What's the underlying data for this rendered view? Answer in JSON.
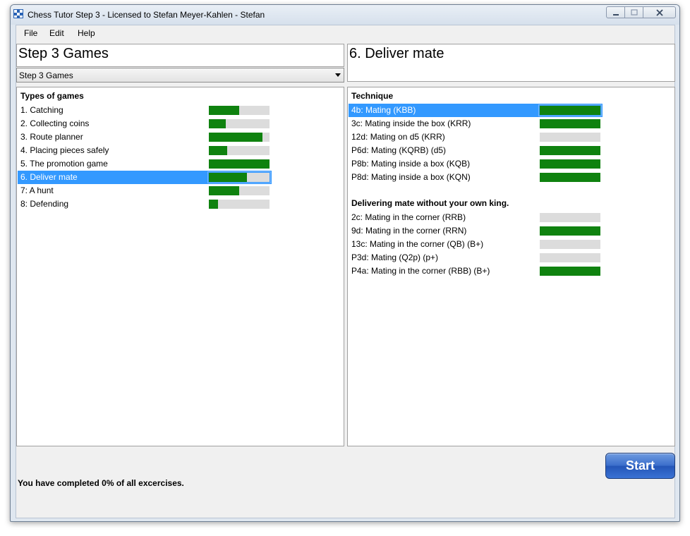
{
  "window": {
    "title": "Chess Tutor Step 3 - Licensed to Stefan Meyer-Kahlen - Stefan"
  },
  "menu": [
    "File",
    "Edit",
    "Help"
  ],
  "left_header": {
    "title": "Step 3 Games",
    "combo_value": "Step 3 Games"
  },
  "right_header": {
    "title": "6. Deliver mate"
  },
  "games": {
    "heading": "Types of games",
    "items": [
      {
        "label": "1. Catching",
        "progress": 0.5
      },
      {
        "label": "2. Collecting coins",
        "progress": 0.28
      },
      {
        "label": "3. Route planner",
        "progress": 0.88
      },
      {
        "label": "4. Placing pieces safely",
        "progress": 0.3
      },
      {
        "label": "5. The promotion game",
        "progress": 1.0
      },
      {
        "label": "6. Deliver mate",
        "progress": 0.63,
        "selected": true
      },
      {
        "label": "7: A hunt",
        "progress": 0.5
      },
      {
        "label": "8: Defending",
        "progress": 0.15
      }
    ]
  },
  "technique": {
    "heading": "Technique",
    "items": [
      {
        "label": "4b: Mating (KBB)",
        "progress": 1.0,
        "selected": true
      },
      {
        "label": "3c: Mating inside the box (KRR)",
        "progress": 1.0
      },
      {
        "label": "12d: Mating on d5 (KRR)",
        "progress": 0.0
      },
      {
        "label": "P6d: Mating (KQRB) (d5)",
        "progress": 1.0
      },
      {
        "label": "P8b: Mating inside a box (KQB)",
        "progress": 1.0
      },
      {
        "label": "P8d: Mating inside a box (KQN)",
        "progress": 1.0
      }
    ]
  },
  "without_king": {
    "heading": "Delivering mate without your own king.",
    "items": [
      {
        "label": "2c: Mating in the corner (RRB)",
        "progress": 0.0
      },
      {
        "label": "9d: Mating in the corner (RRN)",
        "progress": 1.0
      },
      {
        "label": "13c: Mating in the corner (QB) (B+)",
        "progress": 0.0
      },
      {
        "label": "P3d: Mating (Q2p) (p+)",
        "progress": 0.0
      },
      {
        "label": "P4a: Mating in the corner (RBB) (B+)",
        "progress": 1.0
      }
    ]
  },
  "status": "You have completed 0% of all excercises.",
  "start_button": "Start",
  "colors": {
    "progress_fill": "#0f820f",
    "progress_track": "#dcdcdc",
    "selection": "#3399ff"
  }
}
